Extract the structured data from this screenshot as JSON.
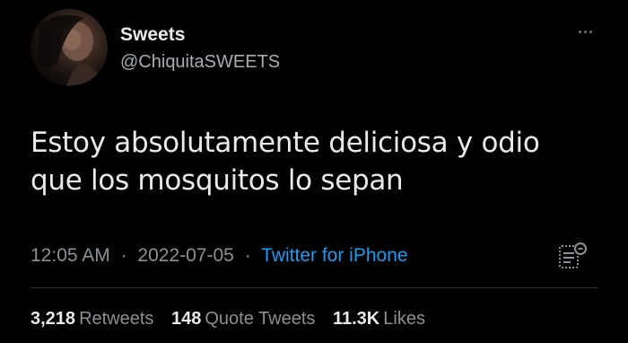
{
  "tweet": {
    "display_name": "Sweets",
    "handle": "@ChiquitaSWEETS",
    "text_line1": "Estoy absolutamente deliciosa y odio",
    "text_line2": "que los mosquitos lo sepan",
    "time": "12:05 AM",
    "date": "2022-07-05",
    "separator": "·",
    "source": "Twitter for iPhone"
  },
  "stats": {
    "retweets_count": "3,218",
    "retweets_label": "Retweets",
    "quotes_count": "148",
    "quotes_label": "Quote Tweets",
    "likes_count": "11.3K",
    "likes_label": "Likes"
  },
  "icons": {
    "more": "more-horizontal-icon",
    "analytics": "analytics-icon"
  },
  "colors": {
    "background": "#000000",
    "text": "#e7e9ea",
    "secondary": "#8b9095",
    "link": "#1d9bf0",
    "divider": "#2f3336"
  }
}
